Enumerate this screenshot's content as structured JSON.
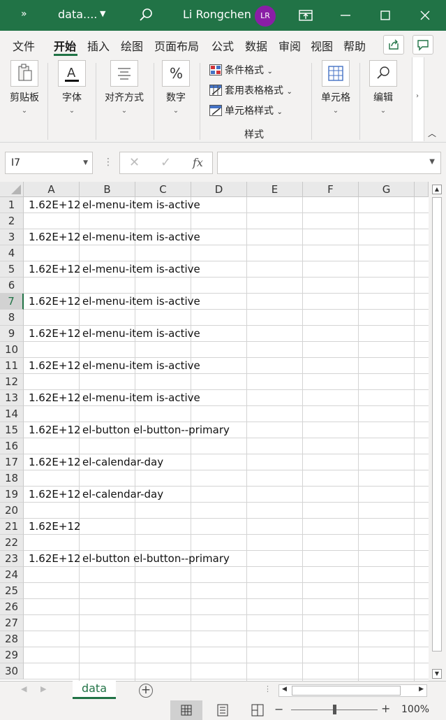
{
  "titlebar": {
    "expand_glyph": "»",
    "filename": "data....",
    "username": "Li Rongchen",
    "avatar_initials": "LR",
    "accent": "#217346"
  },
  "menu": {
    "items": [
      "文件",
      "开始",
      "插入",
      "绘图",
      "页面布局",
      "公式",
      "数据",
      "审阅",
      "视图",
      "帮助"
    ],
    "active": "开始"
  },
  "ribbon": {
    "clipboard": "剪贴板",
    "font": "字体",
    "alignment": "对齐方式",
    "number": "数字",
    "styles": {
      "conditional": "条件格式",
      "table": "套用表格格式",
      "cell": "单元格样式",
      "title": "样式"
    },
    "cells": "单元格",
    "editing": "编辑"
  },
  "formula_bar": {
    "name_box": "I7",
    "formula": ""
  },
  "columns": [
    "A",
    "B",
    "C",
    "D",
    "E",
    "F",
    "G"
  ],
  "rows": [
    "1",
    "2",
    "3",
    "4",
    "5",
    "6",
    "7",
    "8",
    "9",
    "10",
    "11",
    "12",
    "13",
    "14",
    "15",
    "16",
    "17",
    "18",
    "19",
    "20",
    "21",
    "22",
    "23",
    "24",
    "25",
    "26",
    "27",
    "28",
    "29",
    "30"
  ],
  "selected_row": "7",
  "cells": {
    "A1": "1.62E+12",
    "B1": "el-menu-item is-active",
    "A3": "1.62E+12",
    "B3": "el-menu-item is-active",
    "A5": "1.62E+12",
    "B5": "el-menu-item is-active",
    "A7": "1.62E+12",
    "B7": "el-menu-item is-active",
    "A9": "1.62E+12",
    "B9": "el-menu-item is-active",
    "A11": "1.62E+12",
    "B11": "el-menu-item is-active",
    "A13": "1.62E+12",
    "B13": "el-menu-item is-active",
    "A15": "1.62E+12",
    "B15": "el-button el-button--primary",
    "A17": "1.62E+12",
    "B17": "el-calendar-day",
    "A19": "1.62E+12",
    "B19": "el-calendar-day",
    "A21": "1.62E+12",
    "A23": "1.62E+12",
    "B23": "el-button el-button--primary"
  },
  "sheet_tabs": [
    "data"
  ],
  "status": {
    "zoom": "100%"
  }
}
